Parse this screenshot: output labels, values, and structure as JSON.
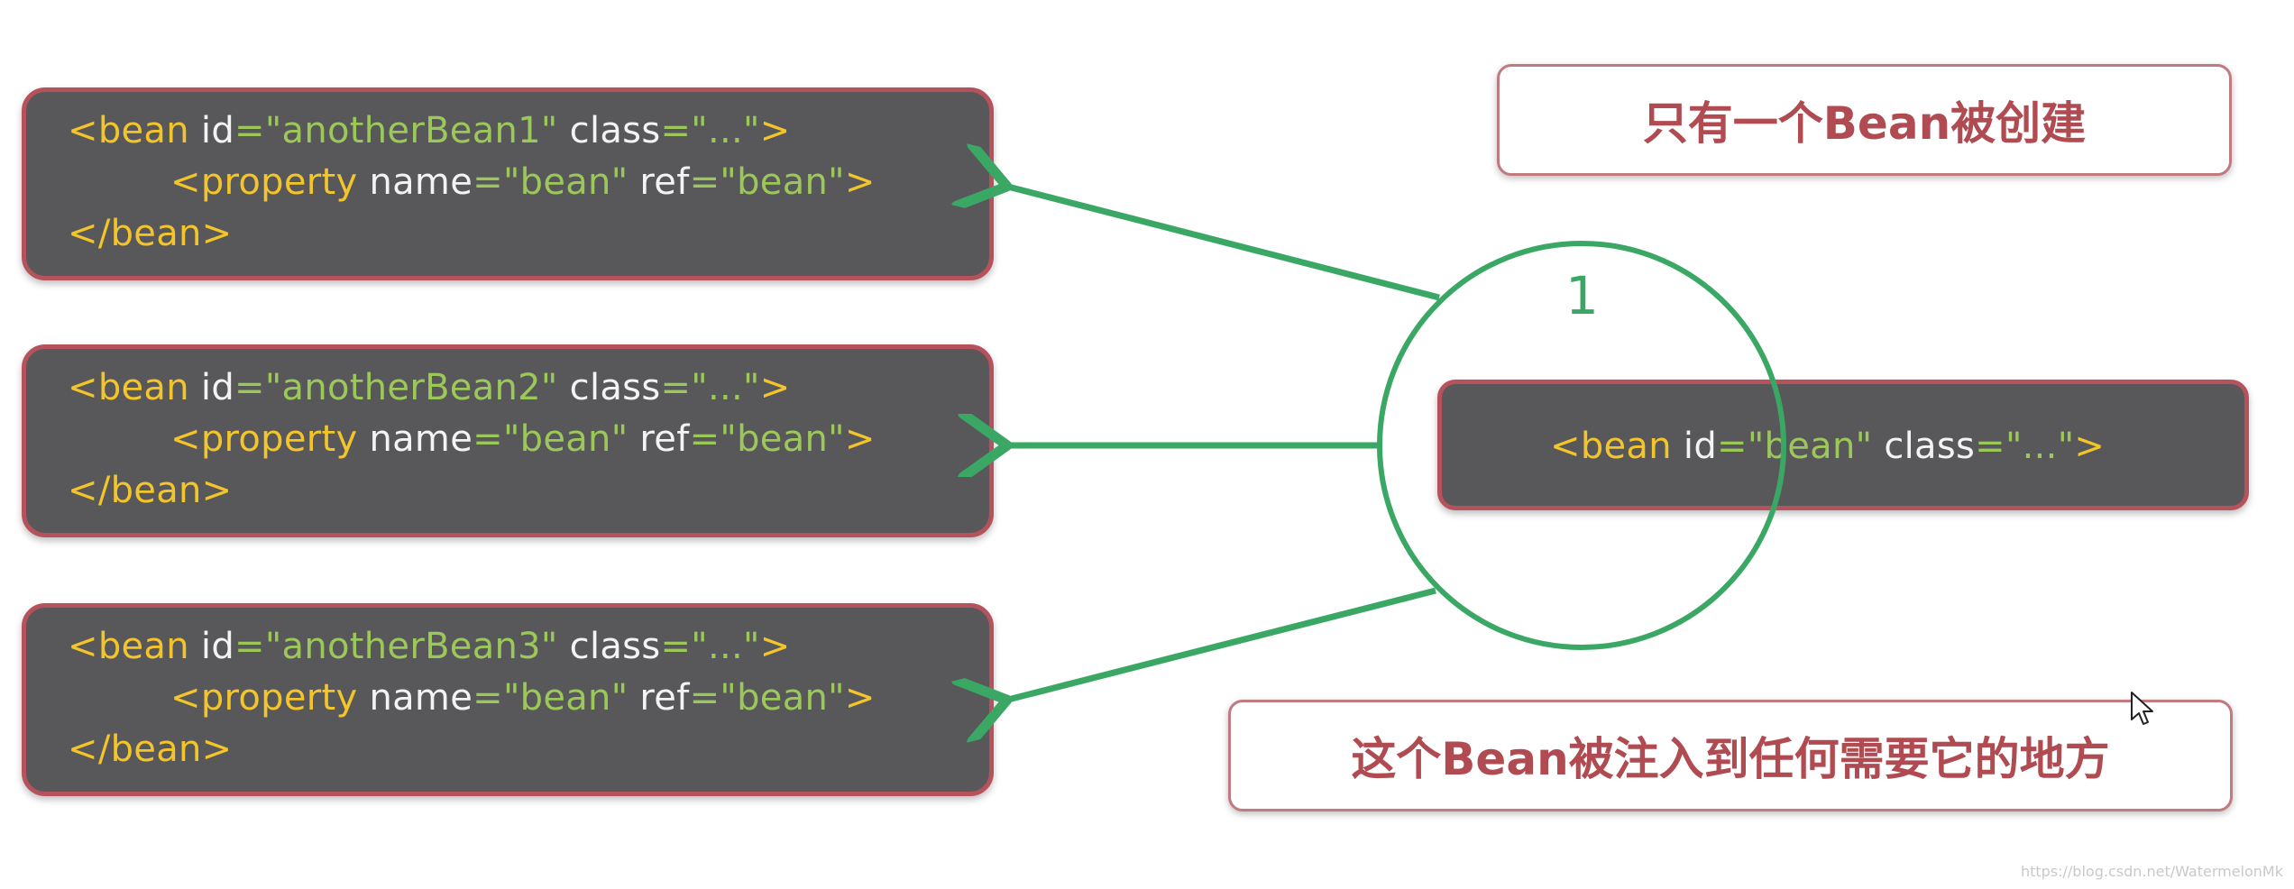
{
  "consumers": [
    {
      "open_lt": "<bean ",
      "id_attr": "id",
      "eq": "=",
      "id_value": "\"anotherBean1\"",
      "class_attr": "class",
      "eq2": "=",
      "class_value": "\"...\"",
      "close": ">",
      "prop_open": "<property ",
      "name_attr": "name",
      "eq3": "=",
      "name_value": "\"bean\"",
      "ref_attr": "ref",
      "eq4": "=",
      "ref_value": "\"bean\"",
      "prop_close": ">",
      "end_tag": "</bean>"
    },
    {
      "open_lt": "<bean ",
      "id_attr": "id",
      "eq": "=",
      "id_value": "\"anotherBean2\"",
      "class_attr": "class",
      "eq2": "=",
      "class_value": "\"...\"",
      "close": ">",
      "prop_open": "<property ",
      "name_attr": "name",
      "eq3": "=",
      "name_value": "\"bean\"",
      "ref_attr": "ref",
      "eq4": "=",
      "ref_value": "\"bean\"",
      "prop_close": ">",
      "end_tag": "</bean>"
    },
    {
      "open_lt": "<bean ",
      "id_attr": "id",
      "eq": "=",
      "id_value": "\"anotherBean3\"",
      "class_attr": "class",
      "eq2": "=",
      "class_value": "\"...\"",
      "close": ">",
      "prop_open": "<property ",
      "name_attr": "name",
      "eq3": "=",
      "name_value": "\"bean\"",
      "ref_attr": "ref",
      "eq4": "=",
      "ref_value": "\"bean\"",
      "prop_close": ">",
      "end_tag": "</bean>"
    }
  ],
  "singleton": {
    "open_lt": "<bean ",
    "id_attr": "id",
    "eq": "=",
    "id_value": "\"bean\"",
    "class_attr": "class",
    "eq2": "=",
    "class_value": "\"...\"",
    "close": ">"
  },
  "notes": {
    "top": "只有一个Bean被创建",
    "bottom": "这个Bean被注入到任何需要它的地方"
  },
  "count_label": "1",
  "watermark": "https://blog.csdn.net/WatermelonMk",
  "colors": {
    "code_bg": "#58585a",
    "code_border": "#b5525b",
    "tag": "#f3c52a",
    "attr": "#f3f3f3",
    "value": "#9cc85a",
    "arrow": "#3aa864",
    "note_text": "#b04b52"
  },
  "icons": {
    "arrow": "arrow-left-icon",
    "cursor": "mouse-cursor-icon"
  }
}
